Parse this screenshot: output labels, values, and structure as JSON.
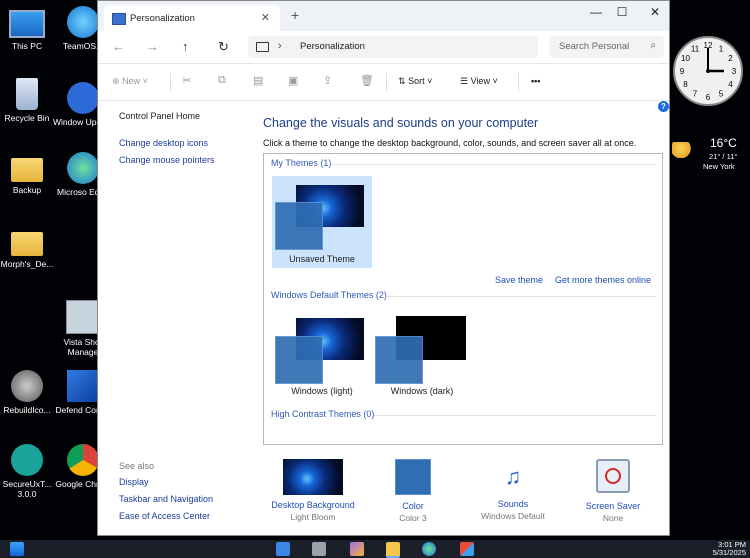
{
  "desktop": {
    "icons": [
      {
        "label": "This PC"
      },
      {
        "label": "TeamOS..."
      },
      {
        "label": "Recycle Bin"
      },
      {
        "label": "Window Update"
      },
      {
        "label": "Backup"
      },
      {
        "label": "Microso Edge"
      },
      {
        "label": "Morph's_De..."
      },
      {
        "label": "Vista Shor Manage"
      },
      {
        "label": "RebuildIco..."
      },
      {
        "label": "Defend Contro"
      },
      {
        "label": "SecureUxT... 3.0.0"
      },
      {
        "label": "Google Chrom"
      }
    ]
  },
  "window": {
    "tab_title": "Personalization",
    "newtab_symbol": "+",
    "controls": {
      "minimize": "—",
      "maximize": "☐",
      "close": "✕"
    },
    "nav": {
      "back": "←",
      "forward": "→",
      "up": "↑",
      "refresh": "↻"
    },
    "breadcrumb": "Personalization",
    "search_placeholder": "Search Personal",
    "toolbar": {
      "new": "New",
      "sort": "Sort",
      "view": "View",
      "more": "•••"
    }
  },
  "left_pane": {
    "home": "Control Panel Home",
    "links": [
      "Change desktop icons",
      "Change mouse pointers"
    ],
    "see_also": "See also",
    "see_also_links": [
      "Display",
      "Taskbar and Navigation",
      "Ease of Access Center"
    ]
  },
  "main": {
    "title": "Change the visuals and sounds on your computer",
    "subtitle": "Click a theme to change the desktop background, color, sounds, and screen saver all at once.",
    "groups": {
      "my_themes": "My Themes (1)",
      "default_themes": "Windows Default Themes (2)",
      "high_contrast": "High Contrast Themes (0)"
    },
    "themes": {
      "unsaved": "Unsaved Theme",
      "light": "Windows (light)",
      "dark": "Windows (dark)"
    },
    "save_theme": "Save theme",
    "get_more": "Get more themes online"
  },
  "bottom": [
    {
      "label": "Desktop Background",
      "value": "Light Bloom"
    },
    {
      "label": "Color",
      "value": "Color 3"
    },
    {
      "label": "Sounds",
      "value": "Windows Default"
    },
    {
      "label": "Screen Saver",
      "value": "None"
    }
  ],
  "gadgets": {
    "clock_numbers": [
      "12",
      "1",
      "2",
      "3",
      "4",
      "5",
      "6",
      "7",
      "8",
      "9",
      "10",
      "11"
    ],
    "temp": "16°C",
    "range": "21° / 11°",
    "city": "New York"
  },
  "taskbar": {
    "time": "3:01 PM",
    "date": "5/31/2025"
  },
  "colors": {
    "link": "#1e4fb5",
    "title_blue": "#1e3d87",
    "selection": "#cce4fb"
  }
}
